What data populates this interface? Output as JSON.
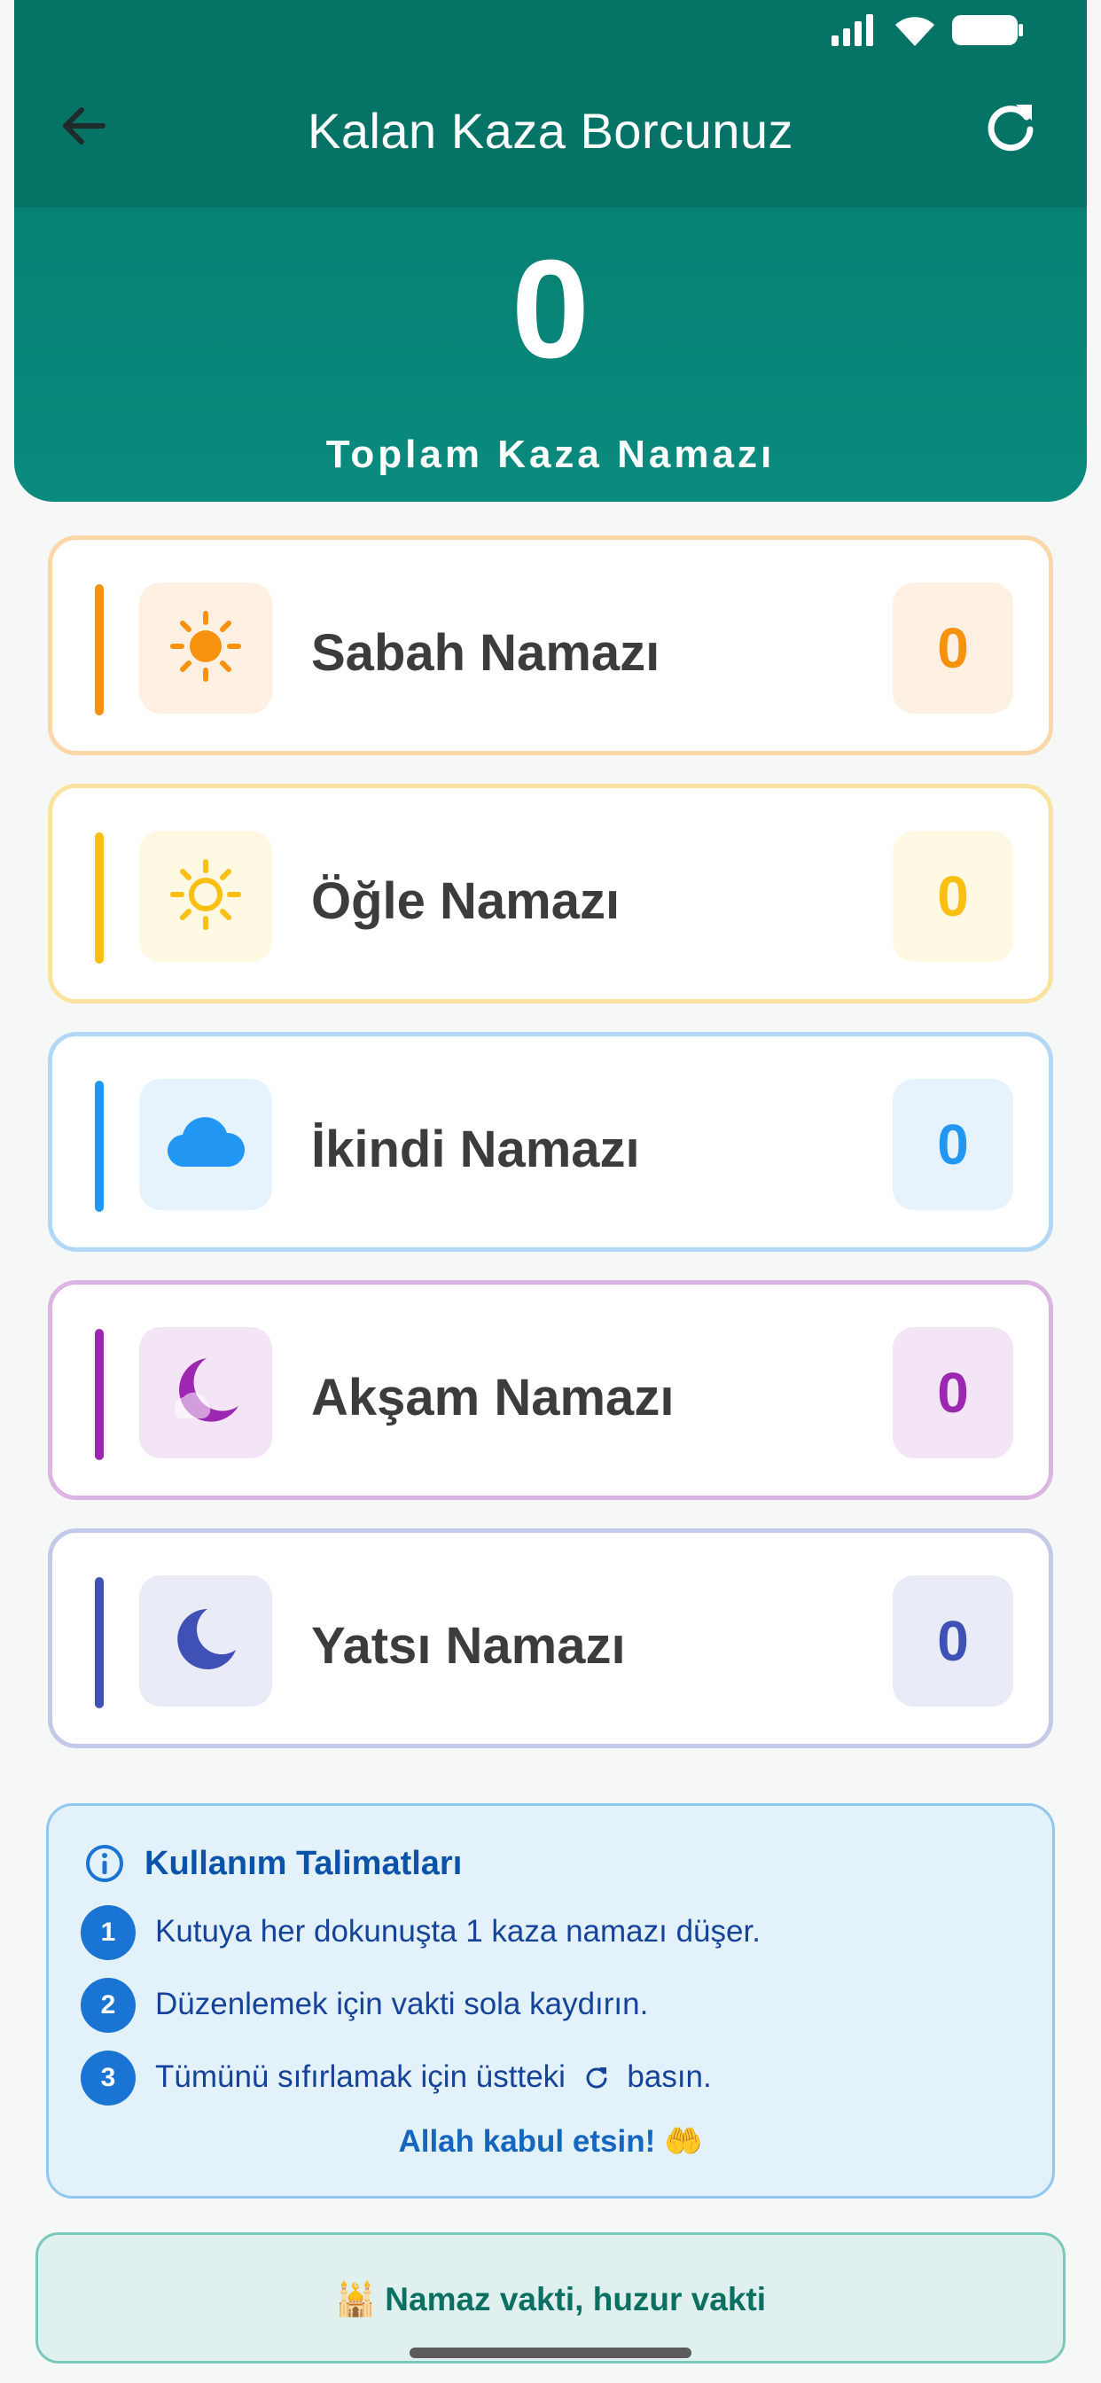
{
  "header": {
    "title": "Kalan Kaza Borcunuz",
    "total_count": "0",
    "total_label": "Toplam Kaza Namazı",
    "back_icon": "arrow-left-icon",
    "refresh_icon": "refresh-icon"
  },
  "status_bar": {
    "icons": [
      "signal-icon",
      "wifi-icon",
      "battery-icon"
    ]
  },
  "prayers": [
    {
      "name": "Sabah Namazı",
      "count": "0",
      "icon": "sun-filled-icon",
      "accent": "#f7920f",
      "soft": "#fef1e3",
      "border": "#fbd7a8"
    },
    {
      "name": "Öğle Namazı",
      "count": "0",
      "icon": "sun-outline-icon",
      "accent": "#f9bf13",
      "soft": "#fff8e2",
      "border": "#fbe39f"
    },
    {
      "name": "İkindi Namazı",
      "count": "0",
      "icon": "cloud-icon",
      "accent": "#2196f3",
      "soft": "#e6f3fd",
      "border": "#b2d8f8"
    },
    {
      "name": "Akşam Namazı",
      "count": "0",
      "icon": "moon-cloud-icon",
      "accent": "#9c27b0",
      "soft": "#f3e5f6",
      "border": "#ddb5e5"
    },
    {
      "name": "Yatsı Namazı",
      "count": "0",
      "icon": "crescent-moon-icon",
      "accent": "#3f51b5",
      "soft": "#e9ebf6",
      "border": "#c3c9e8"
    }
  ],
  "instructions": {
    "title": "Kullanım Talimatları",
    "steps": [
      {
        "num": "1",
        "text": "Kutuya her dokunuşta 1 kaza namazı düşer."
      },
      {
        "num": "2",
        "text": "Düzenlemek için vakti sola kaydırın."
      },
      {
        "num": "3",
        "text_before": "Tümünü sıfırlamak için üstteki",
        "text_after": "basın."
      }
    ],
    "blessing": "Allah kabul etsin! 🤲"
  },
  "footer": {
    "text": "🕌 Namaz vakti, huzur vakti"
  }
}
